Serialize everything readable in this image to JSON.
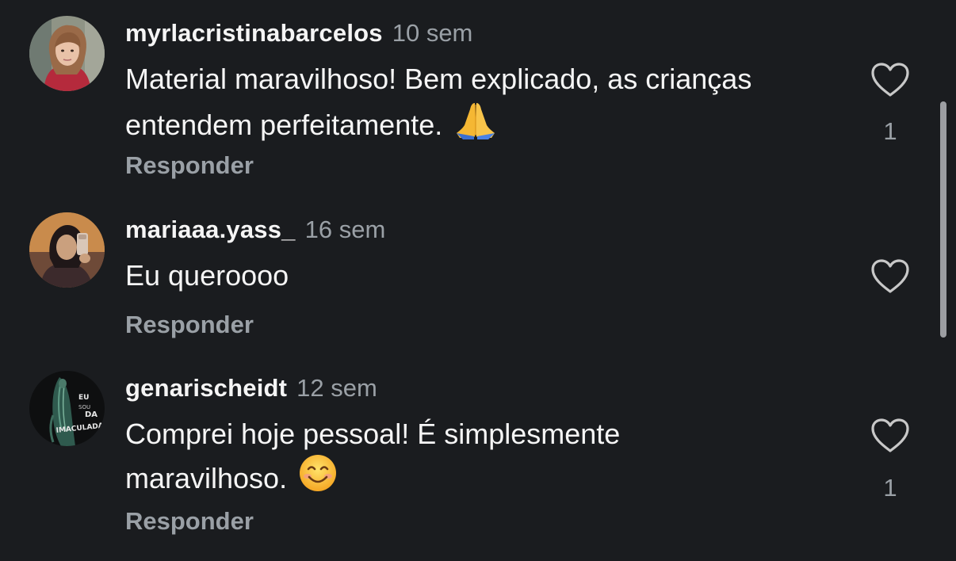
{
  "comments": [
    {
      "username": "myrlacristinabarcelos",
      "time": "10 sem",
      "text": "Material maravilhoso! Bem explicado, as crianças entendem perfeitamente.",
      "emoji": "folded-hands",
      "reply_label": "Responder",
      "likes": "1",
      "avatar": "woman-portrait-avatar"
    },
    {
      "username": "mariaaa.yass_",
      "time": "16 sem",
      "text": "Eu queroooo",
      "reply_label": "Responder",
      "likes": "",
      "avatar": "mirror-selfie-avatar"
    },
    {
      "username": "genarischeidt",
      "time": "12 sem",
      "text": "Comprei hoje pessoal! É simplesmente maravilhoso.",
      "emoji": "smiling-face",
      "reply_label": "Responder",
      "likes": "1",
      "avatar": "imaculada-poster-avatar",
      "avatar_text": {
        "eu": "EU",
        "sou": "SOU",
        "da": "DA",
        "imaculada": "IMACULADA!"
      }
    }
  ],
  "colors": {
    "background": "#1a1c1f",
    "primary_text": "#f5f5f5",
    "secondary_text": "#9aa0a6",
    "heart_outline": "#c8c8c8"
  }
}
